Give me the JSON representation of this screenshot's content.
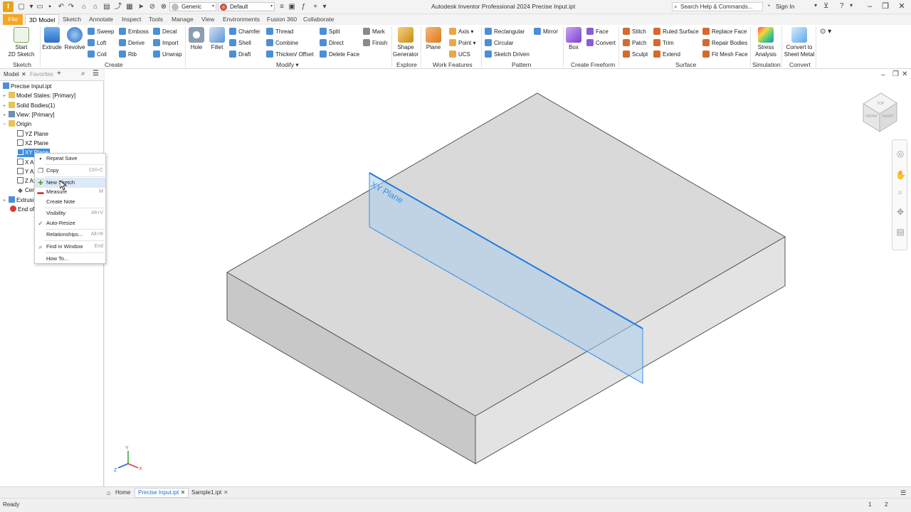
{
  "titlebar": {
    "material": "Generic",
    "appearance": "Default",
    "title": "Autodesk Inventor Professional 2024   Precise Input.ipt",
    "search_placeholder": "Search Help & Commands...",
    "sign_in": "Sign In",
    "app_letter": "I"
  },
  "tabs": [
    "File",
    "3D Model",
    "Sketch",
    "Annotate",
    "Inspect",
    "Tools",
    "Manage",
    "View",
    "Environments",
    "Fusion 360",
    "Collaborate"
  ],
  "ribbon": {
    "sketch": {
      "start_label_1": "Start",
      "start_label_2": "2D Sketch",
      "group": "Sketch"
    },
    "create": {
      "extrude": "Extrude",
      "revolve": "Revolve",
      "sweep": "Sweep",
      "loft": "Loft",
      "coil": "Coil",
      "emboss": "Emboss",
      "derive": "Derive",
      "rib": "Rib",
      "decal": "Decal",
      "import": "Import",
      "unwrap": "Unwrap",
      "group": "Create"
    },
    "modify": {
      "hole": "Hole",
      "fillet": "Fillet",
      "chamfer": "Chamfer",
      "shell": "Shell",
      "draft": "Draft",
      "thread": "Thread",
      "combine": "Combine",
      "thicken": "Thicken/ Offset",
      "split": "Split",
      "direct": "Direct",
      "delete_face": "Delete Face",
      "mark": "Mark",
      "finish": "Finish",
      "group": "Modify"
    },
    "explore": {
      "shape_1": "Shape",
      "shape_2": "Generator",
      "group": "Explore"
    },
    "work": {
      "plane": "Plane",
      "axis": "Axis",
      "point": "Point",
      "ucs": "UCS",
      "group": "Work Features"
    },
    "pattern": {
      "rectangular": "Rectangular",
      "circular": "Circular",
      "sketch_driven": "Sketch Driven",
      "mirror": "Mirror",
      "group": "Pattern"
    },
    "freeform": {
      "box": "Box",
      "face": "Face",
      "convert": "Convert",
      "group": "Create Freeform"
    },
    "surface": {
      "stitch": "Stitch",
      "patch": "Patch",
      "sculpt": "Sculpt",
      "ruled": "Ruled Surface",
      "trim": "Trim",
      "extend": "Extend",
      "replace": "Replace Face",
      "repair": "Repair Bodies",
      "fitmesh": "Fit Mesh Face",
      "group": "Surface"
    },
    "simulation": {
      "stress_1": "Stress",
      "stress_2": "Analysis",
      "group": "Simulation"
    },
    "convert": {
      "c1": "Convert to",
      "c2": "Sheet Metal",
      "group": "Convert"
    }
  },
  "browser": {
    "tab_model": "Model",
    "tab_favorites": "Favorites",
    "nodes": [
      "Precise Input.ipt",
      "Model States: [Primary]",
      "Solid Bodies(1)",
      "View: [Primary]",
      "Origin",
      "YZ Plane",
      "XZ Plane",
      "XY Plane",
      "X Axis",
      "Y Axis",
      "Z Axis",
      "Center Point",
      "Extrusion1",
      "End of Part"
    ]
  },
  "context_menu": {
    "items": [
      {
        "label": "Repeat Save",
        "shortcut": ""
      },
      {
        "label": "Copy",
        "shortcut": "Ctrl+C"
      },
      {
        "label": "New Sketch",
        "shortcut": ""
      },
      {
        "label": "Measure",
        "shortcut": "M"
      },
      {
        "label": "Create Note",
        "shortcut": ""
      },
      {
        "label": "Visibility",
        "shortcut": "Alt+V"
      },
      {
        "label": "Auto-Resize",
        "shortcut": ""
      },
      {
        "label": "Relationships...",
        "shortcut": "Alt+R"
      },
      {
        "label": "Find in Window",
        "shortcut": "End"
      },
      {
        "label": "How To...",
        "shortcut": ""
      }
    ]
  },
  "viewport": {
    "plane_label": "XY Plane",
    "axis_x": "X",
    "axis_y": "Y",
    "axis_z": "Z",
    "cube_top": "TOP",
    "cube_front": "FRONT",
    "cube_right": "RIGHT"
  },
  "doc_tabs": [
    "Home",
    "Precise Input.ipt",
    "Sample1.ipt"
  ],
  "status": {
    "text": "Ready",
    "n1": "1",
    "n2": "2"
  },
  "colors": {
    "accent": "#1d6fd1",
    "file_tab": "#f5a623",
    "plane_fill": "#a9cdee",
    "plane_edge": "#3b8fe0",
    "block_top": "#d8d8d8",
    "block_front": "#c9c9c9",
    "block_side": "#e4e4e4"
  }
}
